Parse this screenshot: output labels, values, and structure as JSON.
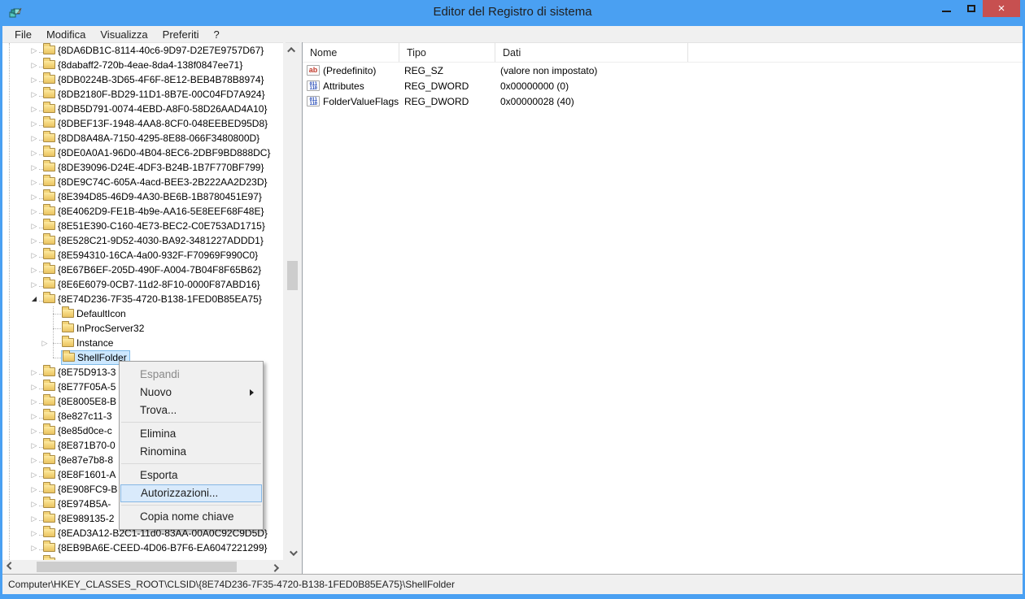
{
  "window": {
    "title": "Editor del Registro di sistema",
    "controls": {
      "minimize": "minimize",
      "maximize": "maximize",
      "close_glyph": "×"
    }
  },
  "colors": {
    "titlebar_blue": "#4aa0f2",
    "close_red": "#c75050",
    "tree_selection_bg": "#cde8ff",
    "menu_highlight_bg": "#d9eafb",
    "folder_yellow": "#f3d479"
  },
  "menubar": {
    "items": [
      {
        "key": "file",
        "label": "File"
      },
      {
        "key": "modifica",
        "label": "Modifica"
      },
      {
        "key": "visualizza",
        "label": "Visualizza"
      },
      {
        "key": "preferiti",
        "label": "Preferiti"
      },
      {
        "key": "help",
        "label": "?"
      }
    ]
  },
  "tree": {
    "glyphs": {
      "collapsed": "▷",
      "expanded": "◢"
    },
    "items": [
      {
        "label": "{8DA6DB1C-8114-40c6-9D97-D2E7E9757D67}",
        "level": 0,
        "state": "collapsed"
      },
      {
        "label": "{8dabaff2-720b-4eae-8da4-138f0847ee71}",
        "level": 0,
        "state": "collapsed"
      },
      {
        "label": "{8DB0224B-3D65-4F6F-8E12-BEB4B78B8974}",
        "level": 0,
        "state": "collapsed"
      },
      {
        "label": "{8DB2180F-BD29-11D1-8B7E-00C04FD7A924}",
        "level": 0,
        "state": "collapsed"
      },
      {
        "label": "{8DB5D791-0074-4EBD-A8F0-58D26AAD4A10}",
        "level": 0,
        "state": "collapsed"
      },
      {
        "label": "{8DBEF13F-1948-4AA8-8CF0-048EEBED95D8}",
        "level": 0,
        "state": "collapsed"
      },
      {
        "label": "{8DD8A48A-7150-4295-8E88-066F3480800D}",
        "level": 0,
        "state": "collapsed"
      },
      {
        "label": "{8DE0A0A1-96D0-4B04-8EC6-2DBF9BD888DC}",
        "level": 0,
        "state": "collapsed"
      },
      {
        "label": "{8DE39096-D24E-4DF3-B24B-1B7F770BF799}",
        "level": 0,
        "state": "collapsed"
      },
      {
        "label": "{8DE9C74C-605A-4acd-BEE3-2B222AA2D23D}",
        "level": 0,
        "state": "collapsed"
      },
      {
        "label": "{8E394D85-46D9-4A30-BE6B-1B8780451E97}",
        "level": 0,
        "state": "collapsed"
      },
      {
        "label": "{8E4062D9-FE1B-4b9e-AA16-5E8EEF68F48E}",
        "level": 0,
        "state": "collapsed"
      },
      {
        "label": "{8E51E390-C160-4E73-BEC2-C0E753AD1715}",
        "level": 0,
        "state": "collapsed"
      },
      {
        "label": "{8E528C21-9D52-4030-BA92-3481227ADDD1}",
        "level": 0,
        "state": "collapsed"
      },
      {
        "label": "{8E594310-16CA-4a00-932F-F70969F990C0}",
        "level": 0,
        "state": "collapsed"
      },
      {
        "label": "{8E67B6EF-205D-490F-A004-7B04F8F65B62}",
        "level": 0,
        "state": "collapsed"
      },
      {
        "label": "{8E6E6079-0CB7-11d2-8F10-0000F87ABD16}",
        "level": 0,
        "state": "collapsed"
      },
      {
        "label": "{8E74D236-7F35-4720-B138-1FED0B85EA75}",
        "level": 0,
        "state": "expanded"
      },
      {
        "label": "DefaultIcon",
        "level": 1,
        "state": "leaf"
      },
      {
        "label": "InProcServer32",
        "level": 1,
        "state": "leaf"
      },
      {
        "label": "Instance",
        "level": 1,
        "state": "collapsed"
      },
      {
        "label": "ShellFolder",
        "level": 1,
        "state": "leaf",
        "selected": true
      },
      {
        "label": "{8E75D913-3",
        "level": 0,
        "state": "collapsed"
      },
      {
        "label": "{8E77F05A-5",
        "level": 0,
        "state": "collapsed"
      },
      {
        "label": "{8E8005E8-B",
        "level": 0,
        "state": "collapsed"
      },
      {
        "label": "{8e827c11-3",
        "level": 0,
        "state": "collapsed"
      },
      {
        "label": "{8e85d0ce-c",
        "level": 0,
        "state": "collapsed"
      },
      {
        "label": "{8E871B70-0",
        "level": 0,
        "state": "collapsed"
      },
      {
        "label": "{8e87e7b8-8",
        "level": 0,
        "state": "collapsed"
      },
      {
        "label": "{8E8F1601-A",
        "level": 0,
        "state": "collapsed"
      },
      {
        "label": "{8E908FC9-B",
        "level": 0,
        "state": "collapsed"
      },
      {
        "label": "{8E974B5A-",
        "level": 0,
        "state": "collapsed"
      },
      {
        "label": "{8E989135-2",
        "level": 0,
        "state": "collapsed"
      },
      {
        "label": "{8EAD3A12-B2C1-11d0-83AA-00A0C92C9D5D}",
        "level": 0,
        "state": "collapsed"
      },
      {
        "label": "{8EB9BA6E-CEED-4D06-B7F6-EA6047221299}",
        "level": 0,
        "state": "collapsed"
      },
      {
        "label": "",
        "level": 0,
        "state": "collapsed"
      }
    ]
  },
  "list": {
    "columns": [
      "Nome",
      "Tipo",
      "Dati"
    ],
    "icons": {
      "reg_sz": "ab",
      "reg_dword": [
        "011",
        "110"
      ]
    },
    "rows": [
      {
        "icon": "reg_sz",
        "name": "(Predefinito)",
        "type": "REG_SZ",
        "data": "(valore non impostato)"
      },
      {
        "icon": "reg_dword",
        "name": "Attributes",
        "type": "REG_DWORD",
        "data": "0x00000000 (0)"
      },
      {
        "icon": "reg_dword",
        "name": "FolderValueFlags",
        "type": "REG_DWORD",
        "data": "0x00000028 (40)"
      }
    ]
  },
  "context_menu": {
    "items": [
      {
        "label": "Espandi",
        "disabled": true
      },
      {
        "label": "Nuovo",
        "submenu": true
      },
      {
        "label": "Trova..."
      },
      {
        "separator": true
      },
      {
        "label": "Elimina"
      },
      {
        "label": "Rinomina"
      },
      {
        "separator": true
      },
      {
        "label": "Esporta"
      },
      {
        "label": "Autorizzazioni...",
        "highlighted": true
      },
      {
        "separator": true
      },
      {
        "label": "Copia nome chiave"
      }
    ]
  },
  "statusbar": {
    "path": "Computer\\HKEY_CLASSES_ROOT\\CLSID\\{8E74D236-7F35-4720-B138-1FED0B85EA75}\\ShellFolder"
  }
}
